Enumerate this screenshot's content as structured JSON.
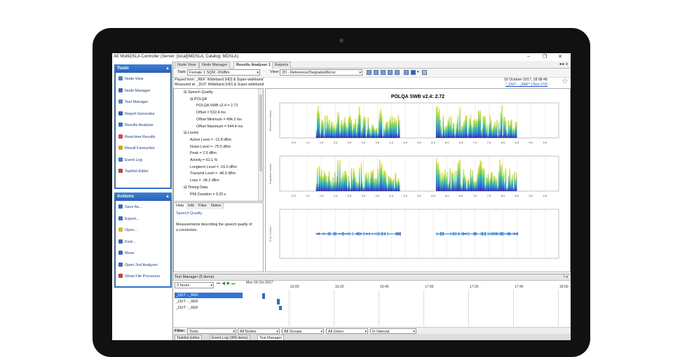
{
  "window": {
    "title": "AE MultiDSLA Controller (Server: [local]\\MDSLA, Catalog: MDSLA)",
    "minimize": "–",
    "maximize": "❐",
    "close": "✕"
  },
  "sidebar": {
    "tools_title": "Tools",
    "tools_items": [
      {
        "label": "Node View",
        "icon": "node-view-icon",
        "color": "#4b7bd1"
      },
      {
        "label": "Node Manager",
        "icon": "node-manager-icon",
        "color": "#3b6cc2"
      },
      {
        "label": "Test Manager",
        "icon": "test-manager-icon",
        "color": "#5a86d6"
      },
      {
        "label": "Report Generator",
        "icon": "report-icon",
        "color": "#2e5fb5"
      },
      {
        "label": "Results Analyser",
        "icon": "results-icon",
        "color": "#3a70c8"
      },
      {
        "label": "Real-time Results",
        "icon": "realtime-icon",
        "color": "#d04a4a"
      },
      {
        "label": "Result Favourites",
        "icon": "star-icon",
        "color": "#e0a020"
      },
      {
        "label": "Event Log",
        "icon": "event-log-icon",
        "color": "#4a78c8"
      },
      {
        "label": "Tasklist Editor",
        "icon": "tasklist-icon",
        "color": "#c84040"
      }
    ],
    "actions_title": "Actions",
    "actions_items": [
      {
        "label": "Save As...",
        "icon": "save-icon",
        "color": "#3b6cc2"
      },
      {
        "label": "Export...",
        "icon": "export-icon",
        "color": "#3b6cc2"
      },
      {
        "label": "Open...",
        "icon": "open-icon",
        "color": "#e0b030"
      },
      {
        "label": "Find...",
        "icon": "find-icon",
        "color": "#3b6cc2"
      },
      {
        "label": "Move",
        "icon": "move-icon",
        "color": "#3b6cc2"
      },
      {
        "label": "Open 2nd Analyser",
        "icon": "analyser-icon",
        "color": "#3b6cc2"
      },
      {
        "label": "Show File Processor",
        "icon": "file-processor-icon",
        "color": "#c84040"
      }
    ]
  },
  "tabs": [
    "Node View",
    "Node Manager",
    "Results Analyser 1",
    "Reports"
  ],
  "tabs_nav": "◂ ▸ x",
  "toolbar": {
    "task_label": "Task:",
    "task_value": "Female 1 SQM -20dBm",
    "view_label": "View:",
    "view_value": "2D - Reference/Degraded/Error"
  },
  "info": {
    "played": "Played from: _REF: Wideband (HD) & Super-wideband",
    "measured": "Measured at: _DUT: Wideband (HD) & Super-wideband",
    "date": "16 October 2017, 18:08:48",
    "link": "*_DUT - _REF* (Test 172)"
  },
  "tree": [
    {
      "text": "⊟ Speech Quality",
      "indent": 0
    },
    {
      "text": "⊟ POLQA",
      "indent": 1
    },
    {
      "text": "POLQA SWB v2.4 = 2.72",
      "indent": 2
    },
    {
      "text": "Offset = 532.4 ms",
      "indent": 2
    },
    {
      "text": "Offset Minimum = 494.2 ms",
      "indent": 2
    },
    {
      "text": "Offset Maximum = 544.4 ms",
      "indent": 2
    },
    {
      "text": "⊟ Levels",
      "indent": 0
    },
    {
      "text": "Active Level = -13.8 dBm",
      "indent": 1
    },
    {
      "text": "Noise Level = -75.5 dBm",
      "indent": 1
    },
    {
      "text": "Peak = 2.9 dBm",
      "indent": 1
    },
    {
      "text": "Activity = 61.1 %",
      "indent": 1
    },
    {
      "text": "Longterm Level = -16.0 dBm",
      "indent": 1
    },
    {
      "text": "Transmit Level = -48.0 dBm",
      "indent": 1
    },
    {
      "text": "Loss = -34.2 dBm",
      "indent": 1
    },
    {
      "text": "⊟ Timing Data",
      "indent": 0
    },
    {
      "text": "P56 Duration = 9.25 s",
      "indent": 1
    }
  ],
  "help": {
    "tabs": [
      "Help",
      "Info",
      "Files",
      "Notes"
    ],
    "heading": "Speech Quality",
    "body_line1": "Measurements describing the speech quality of",
    "body_line2": "a connection."
  },
  "chart": {
    "title": "POLQA SWB v2.4: 2.72",
    "panels": [
      "Reference Surface",
      "Degraded Surface",
      "Error Surface"
    ],
    "ticks": [
      "0.5",
      "1.0",
      "1.5",
      "2.0",
      "2.5",
      "3.0",
      "3.5",
      "4.0",
      "4.5",
      "5.0",
      "5.5",
      "6.0",
      "6.5",
      "7.0",
      "7.5",
      "8.0",
      "8.5",
      "9.0",
      "9.5"
    ]
  },
  "chart_data": {
    "type": "heatmap",
    "title": "POLQA SWB v2.4: 2.72",
    "xlabel": "",
    "ylabels": [
      "Reference Surface",
      "Degraded Surface",
      "Error Surface"
    ],
    "xlim": [
      0,
      10
    ],
    "x_ticks": [
      0.5,
      1.0,
      1.5,
      2.0,
      2.5,
      3.0,
      3.5,
      4.0,
      4.5,
      5.0,
      5.5,
      6.0,
      6.5,
      7.0,
      7.5,
      8.0,
      8.5,
      9.0,
      9.5
    ],
    "speech_segments": [
      [
        1.3,
        4.3
      ],
      [
        5.6,
        8.5
      ]
    ]
  },
  "test_manager": {
    "title": "Test Manager (5 items)",
    "pin": "ᵖ x",
    "range": "2 hours",
    "date": "Mon 16 Oct 2017",
    "times": [
      "16:00",
      "16:20",
      "16:40",
      "17:00",
      "17:20",
      "17:40",
      "18:00"
    ],
    "rows": [
      "_DUT - _REF",
      "_DUT - _REF",
      "_DUT - _REF"
    ],
    "filter_label": "Filter:",
    "filters": [
      "Tests",
      "All Nodes",
      "All Groups",
      "All Users",
      "In Interval"
    ],
    "bottom_tabs": [
      "Tasklist Editor",
      "Event Log (305 items)",
      "Test Manager"
    ]
  }
}
